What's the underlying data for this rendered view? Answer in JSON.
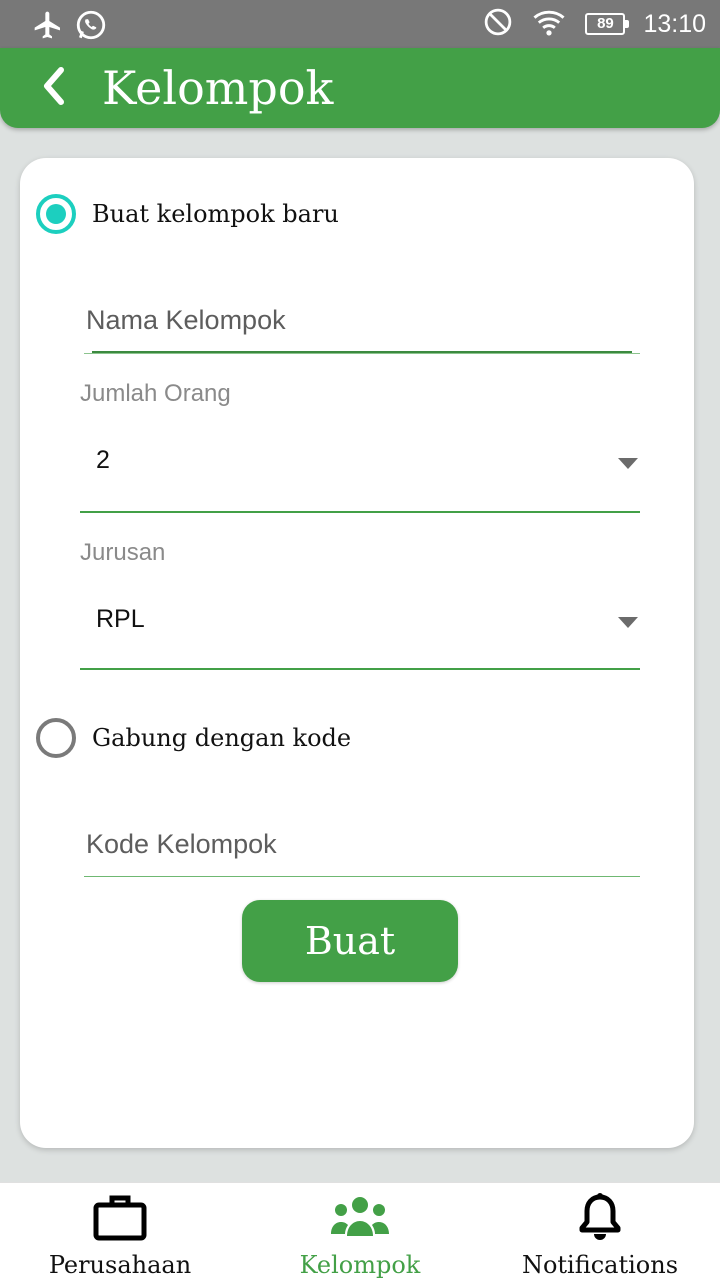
{
  "status_bar": {
    "time": "13:10",
    "battery": "89",
    "icons": [
      "airplane-icon",
      "whatsapp-icon",
      "do-not-disturb-icon",
      "wifi-icon",
      "battery-icon"
    ]
  },
  "app_bar": {
    "title": "Kelompok",
    "back_icon": "chevron-left-icon"
  },
  "form": {
    "option_new": {
      "label": "Buat kelompok baru",
      "selected": true
    },
    "nama_kelompok": {
      "placeholder": "Nama Kelompok",
      "value": ""
    },
    "jumlah_orang": {
      "label": "Jumlah Orang",
      "value": "2"
    },
    "jurusan": {
      "label": "Jurusan",
      "value": "RPL"
    },
    "option_join": {
      "label": "Gabung dengan kode",
      "selected": false
    },
    "kode_kelompok": {
      "placeholder": "Kode Kelompok",
      "value": ""
    },
    "submit_label": "Buat"
  },
  "bottom_nav": {
    "items": [
      {
        "label": "Perusahaan",
        "icon": "briefcase-icon",
        "active": false
      },
      {
        "label": "Kelompok",
        "icon": "group-icon",
        "active": true
      },
      {
        "label": "Notifications",
        "icon": "bell-icon",
        "active": false
      }
    ]
  },
  "colors": {
    "primary": "#43a047",
    "radio_accent": "#1ccfbf",
    "status_bar": "#787878",
    "background": "#dde1e0"
  }
}
